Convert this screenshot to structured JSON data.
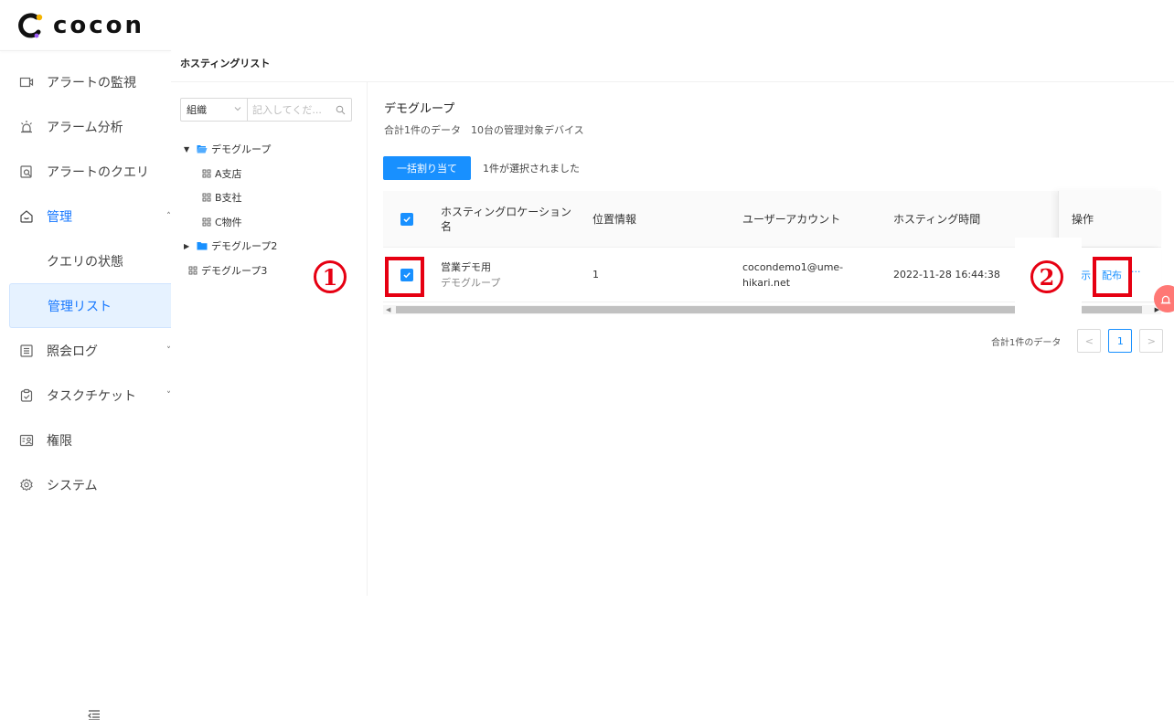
{
  "app": {
    "logo_text": "cocon"
  },
  "sidebar": {
    "items": [
      {
        "label": "アラートの監視",
        "icon": "camera-icon"
      },
      {
        "label": "アラーム分析",
        "icon": "alarm-icon"
      },
      {
        "label": "アラートのクエリ",
        "icon": "query-icon"
      },
      {
        "label": "管理",
        "icon": "home-icon",
        "expanded": true
      },
      {
        "label": "クエリの状態"
      },
      {
        "label": "管理リスト",
        "selected": true
      },
      {
        "label": "照会ログ",
        "icon": "list-icon"
      },
      {
        "label": "タスクチケット",
        "icon": "task-icon"
      },
      {
        "label": "権限",
        "icon": "permission-icon"
      },
      {
        "label": "システム",
        "icon": "gear-icon"
      }
    ]
  },
  "header": {
    "title": "ホスティングリスト"
  },
  "tree_panel": {
    "filter_select": "組織",
    "search_placeholder": "記入してくだ...",
    "nodes": [
      {
        "label": "デモグループ",
        "expanded": true
      },
      {
        "label": "A支店"
      },
      {
        "label": "B支社"
      },
      {
        "label": "C物件"
      },
      {
        "label": "デモグループ2",
        "expanded": false
      },
      {
        "label": "デモグループ3"
      }
    ]
  },
  "main": {
    "group_title": "デモグループ",
    "summary": "合計1件のデータ　10台の管理対象デバイス",
    "bulk_assign_button": "一括割り当て",
    "selection_info": "1件が選択されました",
    "table": {
      "headers": {
        "name_line1": "ホスティングロケーション",
        "name_line2": "名",
        "location": "位置情報",
        "account": "ユーザーアカウント",
        "time": "ホスティング時間",
        "actions": "操作"
      },
      "rows": [
        {
          "checked": true,
          "name": "営業デモ用",
          "group": "デモグループ",
          "location": "1",
          "account_line1": "cocondemo1@ume-",
          "account_line2": "hikari.net",
          "time": "2022-11-28 16:44:38",
          "action_partial": "示",
          "action_distribute": "配布",
          "action_more": "···"
        }
      ]
    },
    "pagination": {
      "total": "合計1件のデータ",
      "current_page": "1"
    }
  },
  "annotations": {
    "one": "1",
    "two": "2"
  },
  "colors": {
    "primary": "#1890ff",
    "annotation": "#e60012",
    "selected_bg": "#e6f2ff"
  }
}
